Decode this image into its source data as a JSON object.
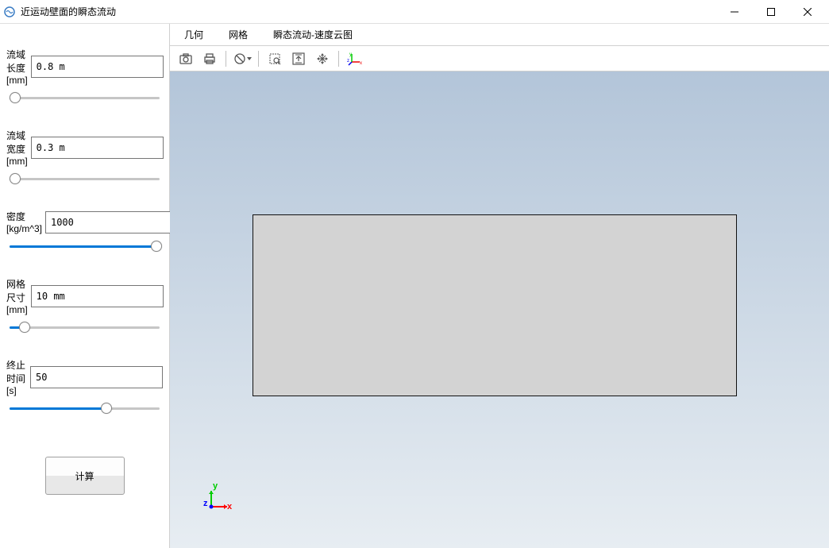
{
  "window": {
    "title": "近运动壁面的瞬态流动"
  },
  "sidebar": {
    "params": [
      {
        "label": "流域长度[mm]",
        "value": "0.8 m",
        "slider_pct": 2
      },
      {
        "label": "流域宽度[mm]",
        "value": "0.3 m",
        "slider_pct": 2
      },
      {
        "label": "密度[kg/m^3]",
        "value": "1000",
        "slider_pct": 98
      },
      {
        "label": "网格尺寸[mm]",
        "value": "10 mm",
        "slider_pct": 8
      },
      {
        "label": "终止时间[s]",
        "value": "50",
        "slider_pct": 64
      }
    ],
    "calc_button": "计算"
  },
  "tabs": [
    {
      "label": "几何",
      "active": true
    },
    {
      "label": "网格",
      "active": false
    },
    {
      "label": "瞬态流动-速度云图",
      "active": false
    }
  ],
  "toolbar": {
    "icons": [
      "camera-icon",
      "print-icon",
      "sep",
      "settings-icon",
      "sep",
      "zoom-select-icon",
      "fit-icon",
      "expand-icon",
      "sep",
      "axis-icon"
    ]
  },
  "axes": {
    "x": "x",
    "y": "y",
    "z": "z"
  }
}
